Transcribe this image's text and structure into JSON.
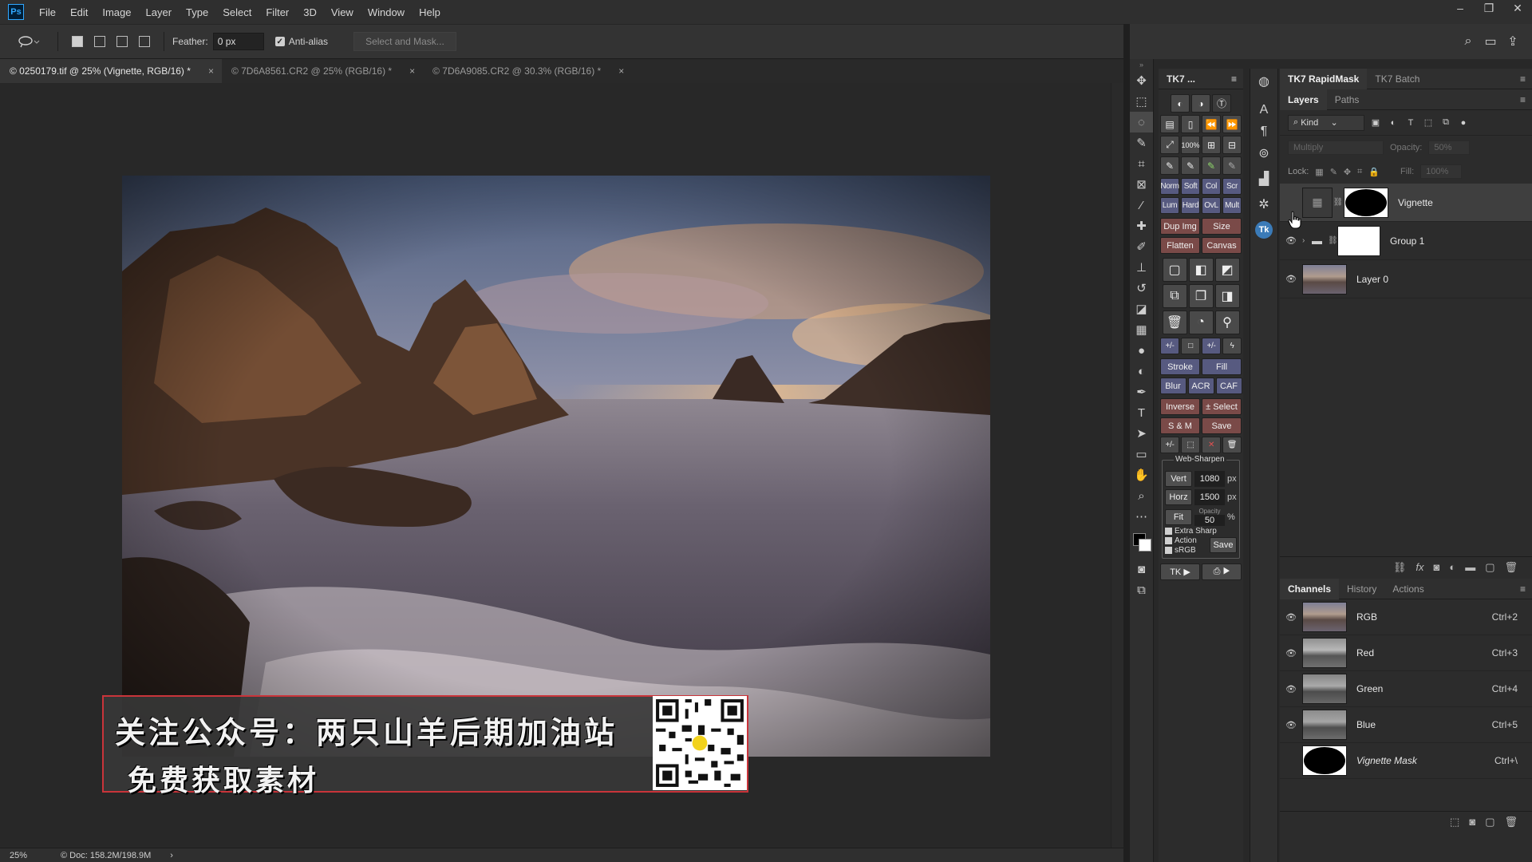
{
  "app": {
    "logo": "Ps",
    "menu": [
      "File",
      "Edit",
      "Image",
      "Layer",
      "Type",
      "Select",
      "Filter",
      "3D",
      "View",
      "Window",
      "Help"
    ],
    "window_controls": [
      "–",
      "❐",
      "✕"
    ]
  },
  "options_bar": {
    "feather_label": "Feather:",
    "feather_value": "0 px",
    "antialias_label": "Anti-alias",
    "antialias_checked": true,
    "select_mask_label": "Select and Mask..."
  },
  "tabs": [
    {
      "label": "© 0250179.tif @ 25% (Vignette, RGB/16) *",
      "close": "×",
      "active": true
    },
    {
      "label": "© 7D6A8561.CR2 @ 25% (RGB/16) *",
      "close": "×",
      "active": false
    },
    {
      "label": "© 7D6A9085.CR2 @ 30.3% (RGB/16) *",
      "close": "×",
      "active": false
    }
  ],
  "overlay": {
    "line1": "关注公众号：两只山羊后期加油站",
    "line2": "免费获取素材"
  },
  "status": {
    "zoom": "25%",
    "doc": "© Doc: 158.2M/198.9M",
    "arrow": "›"
  },
  "tk7": {
    "title": "TK7 ...",
    "blend_row1": [
      "Norm",
      "Soft",
      "Col",
      "Scr"
    ],
    "blend_row2": [
      "Lum",
      "Hard",
      "OvL",
      "Mult"
    ],
    "zoom_label": "100%",
    "buttons": {
      "dup_img": "Dup Img",
      "size": "Size",
      "flatten": "Flatten",
      "canvas": "Canvas",
      "stroke": "Stroke",
      "fill": "Fill",
      "blur": "Blur",
      "acr": "ACR",
      "caf": "CAF",
      "inverse": "Inverse",
      "select": "± Select",
      "sm": "S & M",
      "save": "Save"
    },
    "web_sharpen": {
      "legend": "Web-Sharpen",
      "vert_label": "Vert",
      "vert_value": "1080",
      "horz_label": "Horz",
      "horz_value": "1500",
      "unit": "px",
      "fit_label": "Fit",
      "opacity_label": "Opacity",
      "opacity_value": "50",
      "percent": "%",
      "extra_sharp": "Extra Sharp",
      "action": "Action",
      "srgb": "sRGB",
      "save": "Save"
    },
    "footer": [
      "TK ▶",
      "⎙ ▶"
    ]
  },
  "right_header": {
    "tabs": [
      "TK7 RapidMask",
      "TK7 Batch"
    ]
  },
  "layers_panel": {
    "tabs": [
      "Layers",
      "Paths"
    ],
    "kind_label": "Kind",
    "blend_mode": "Multiply",
    "opacity_label": "Opacity:",
    "opacity_value": "50%",
    "lock_label": "Lock:",
    "fill_label": "Fill:",
    "fill_value": "100%",
    "layers": [
      {
        "name": "Vignette",
        "selected": true
      },
      {
        "name": "Group 1",
        "selected": false
      },
      {
        "name": "Layer 0",
        "selected": false
      }
    ]
  },
  "channels_panel": {
    "tabs": [
      "Channels",
      "History",
      "Actions"
    ],
    "channels": [
      {
        "name": "RGB",
        "shortcut": "Ctrl+2"
      },
      {
        "name": "Red",
        "shortcut": "Ctrl+3"
      },
      {
        "name": "Green",
        "shortcut": "Ctrl+4"
      },
      {
        "name": "Blue",
        "shortcut": "Ctrl+5"
      },
      {
        "name": "Vignette Mask",
        "shortcut": "Ctrl+\\"
      }
    ]
  },
  "colors": {
    "accent": "#31a8ff",
    "banner_border": "#c9343a",
    "tk_button": "#575a80"
  }
}
